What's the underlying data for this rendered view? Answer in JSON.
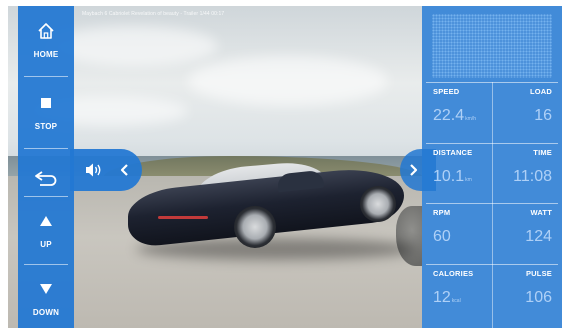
{
  "scene": {
    "title": "Maybach 6 Cabriolet Revelation of beauty - Trailer 1/44 00:17"
  },
  "left_bar": {
    "buttons": [
      {
        "label": "HOME",
        "icon": "home-icon"
      },
      {
        "label": "STOP",
        "icon": "stop-icon"
      },
      {
        "label": "",
        "icon": "back-icon"
      },
      {
        "label": "UP",
        "icon": "up-arrow-icon"
      },
      {
        "label": "DOWN",
        "icon": "down-arrow-icon"
      }
    ]
  },
  "volume_tab": {
    "icon": "volume-icon",
    "collapse_icon": "chevron-left-icon"
  },
  "right_panel": {
    "expand_icon": "chevron-right-icon",
    "metrics": [
      {
        "label": "SPEED",
        "value": "22.4",
        "unit": "km/h"
      },
      {
        "label": "LOAD",
        "value": "16",
        "unit": ""
      },
      {
        "label": "DISTANCE",
        "value": "10.1",
        "unit": "km"
      },
      {
        "label": "TIME",
        "value": "11:08",
        "unit": ""
      },
      {
        "label": "RPM",
        "value": "60",
        "unit": ""
      },
      {
        "label": "WATT",
        "value": "124",
        "unit": ""
      },
      {
        "label": "CALORIES",
        "value": "12",
        "unit": "kcal"
      },
      {
        "label": "PULSE",
        "value": "106",
        "unit": ""
      }
    ]
  },
  "colors": {
    "panel_blue": "#2378d2",
    "text_white": "#ffffff",
    "value_text": "#cde4ff"
  }
}
